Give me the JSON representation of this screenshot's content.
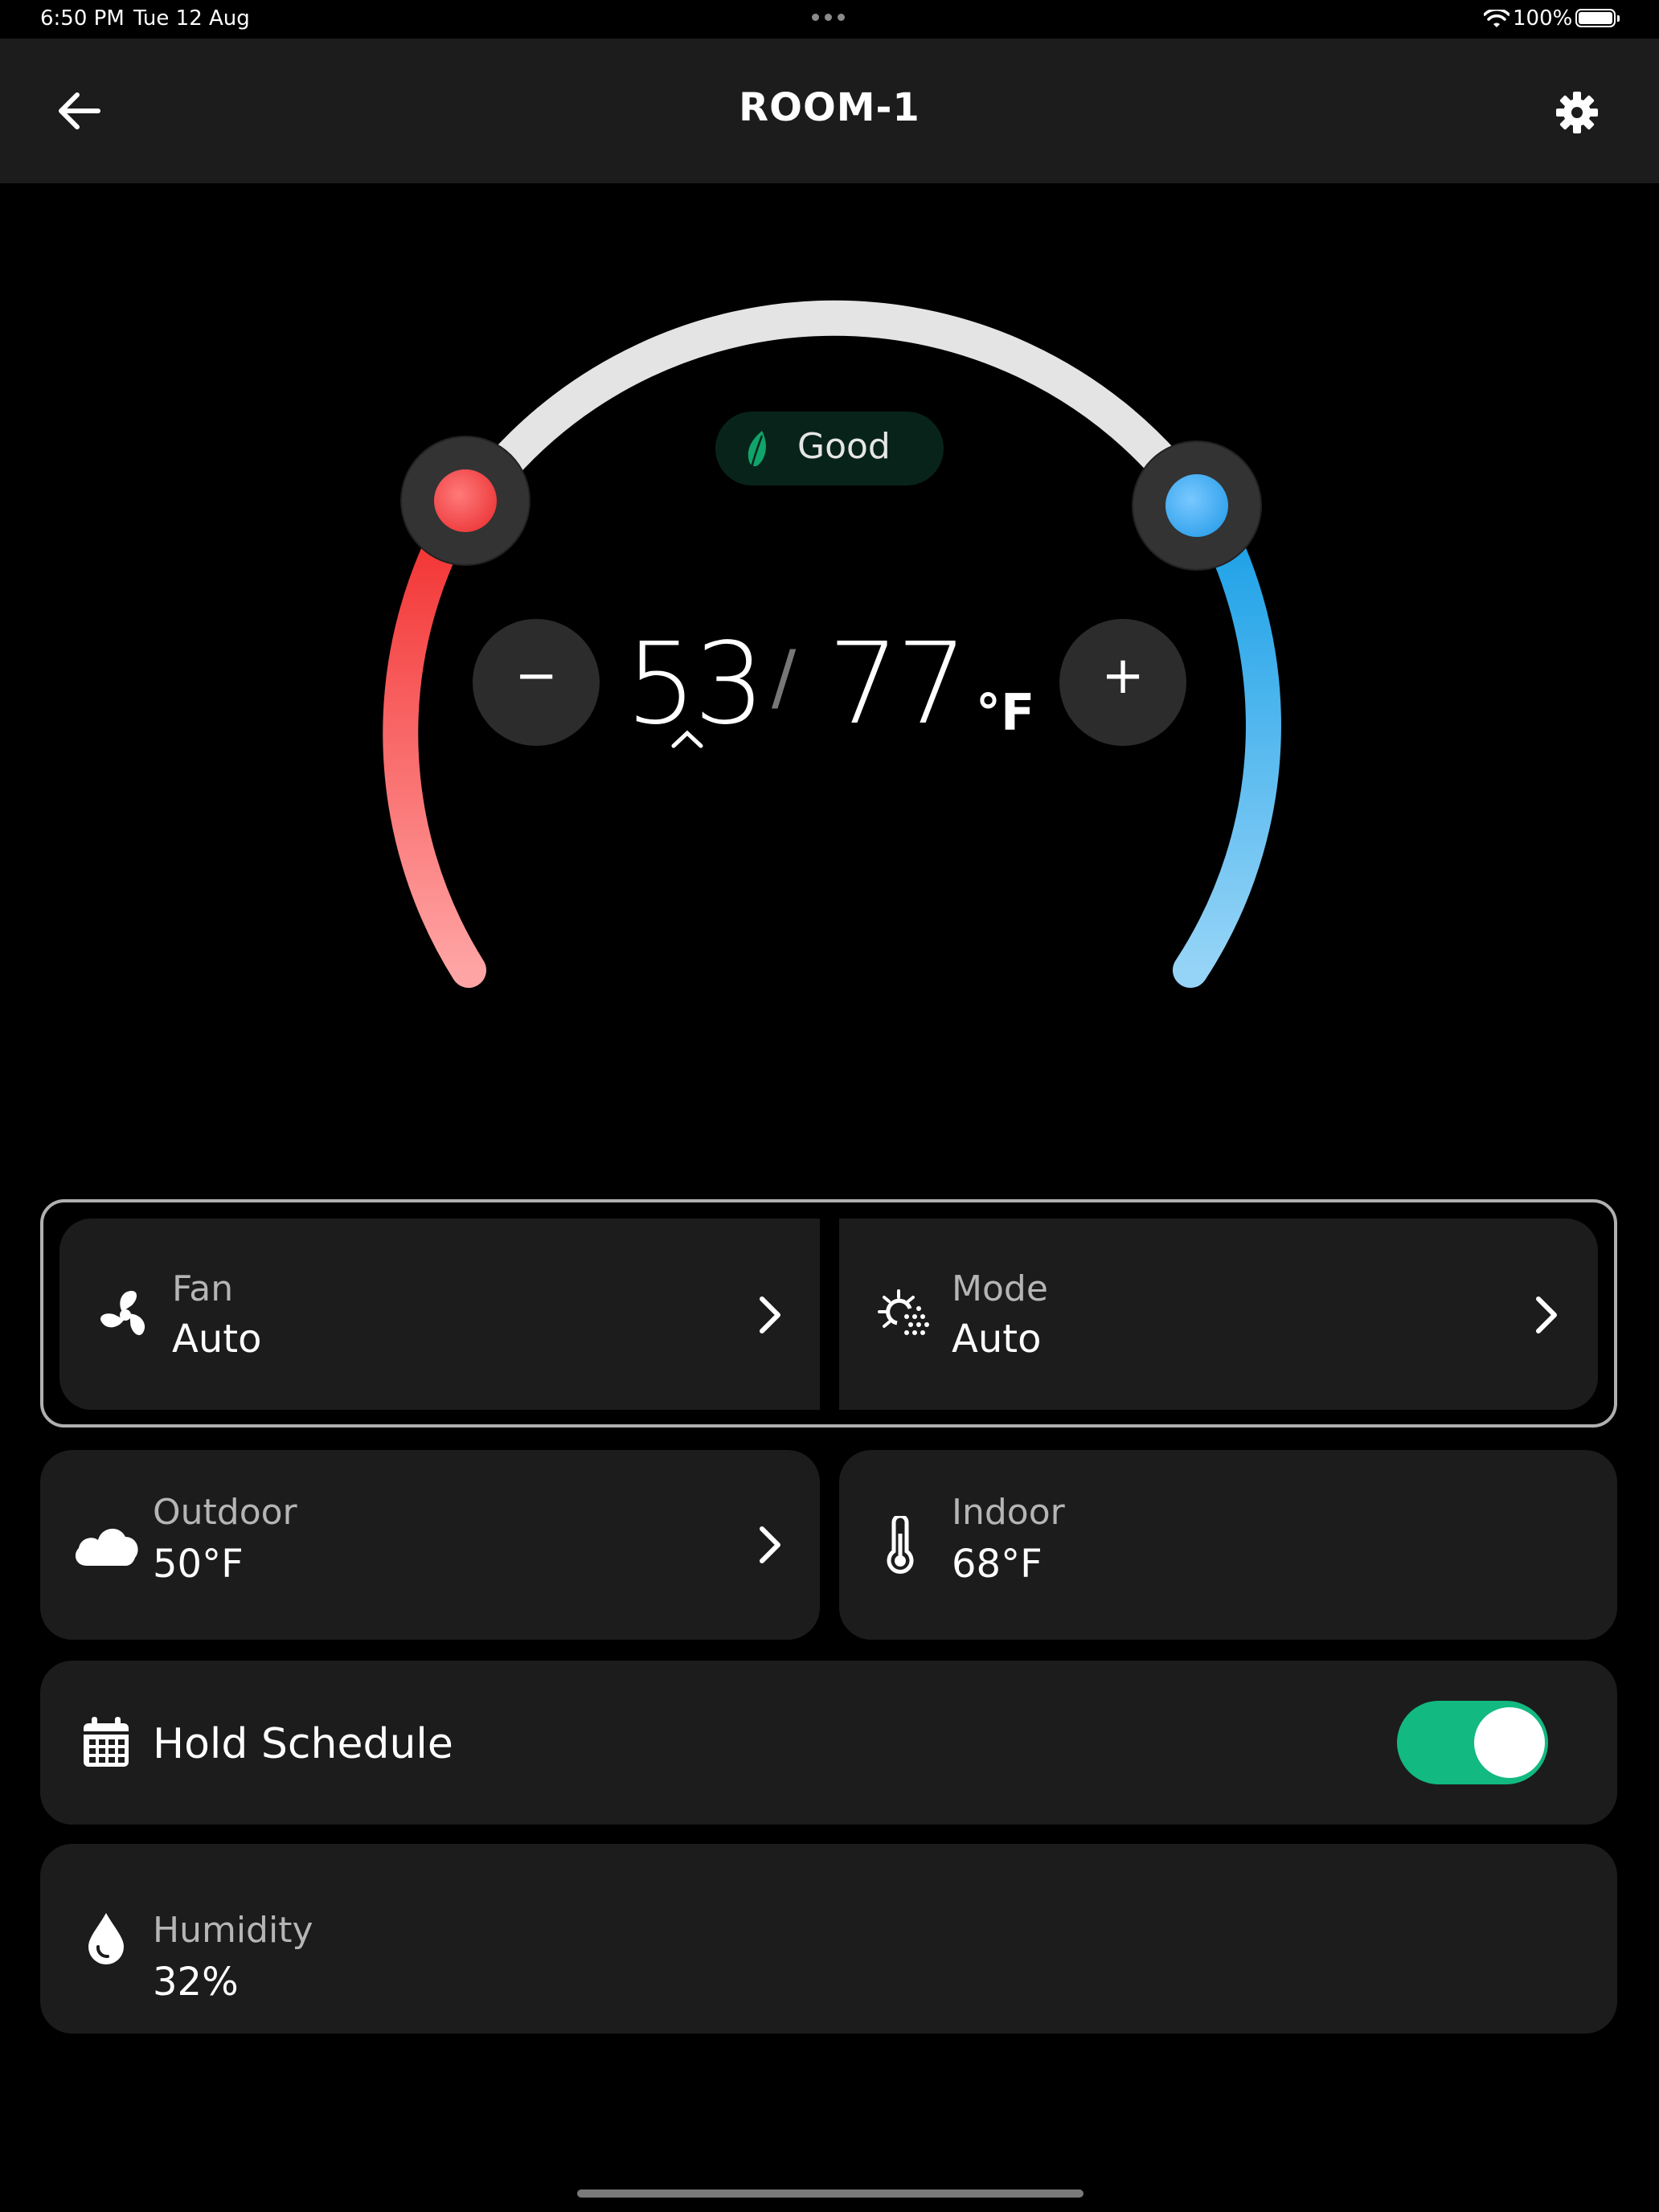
{
  "status_bar": {
    "time": "6:50 PM",
    "date": "Tue 12 Aug",
    "battery": "100%"
  },
  "nav": {
    "title": "ROOM-1",
    "back_icon": "arrow-left-icon",
    "settings_icon": "gear-icon"
  },
  "thermostat": {
    "air_quality": "Good",
    "heat_setpoint": "53",
    "separator": "/",
    "cool_setpoint": "77",
    "unit": "°F",
    "minus_label": "−",
    "plus_label": "+",
    "colors": {
      "heat": "#e8282a",
      "cool": "#1d97e6",
      "track": "#e4e4e4",
      "good": "#10a36b"
    }
  },
  "controls": {
    "fan": {
      "label": "Fan",
      "value": "Auto",
      "icon": "fan-icon"
    },
    "mode": {
      "label": "Mode",
      "value": "Auto",
      "icon": "sun-snow-icon"
    },
    "outdoor": {
      "label": "Outdoor",
      "value": "50°F",
      "icon": "cloud-icon"
    },
    "indoor": {
      "label": "Indoor",
      "value": "68°F",
      "icon": "thermometer-icon"
    },
    "hold_schedule": {
      "label": "Hold Schedule",
      "enabled": true,
      "icon": "calendar-icon",
      "toggle_color": "#12b981"
    },
    "humidity": {
      "label": "Humidity",
      "value": "32%",
      "icon": "droplet-icon"
    }
  }
}
